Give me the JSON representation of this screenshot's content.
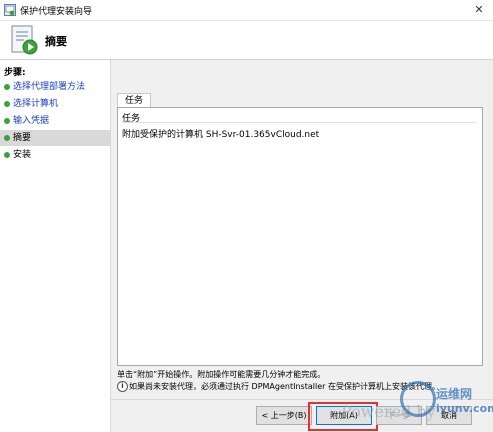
{
  "window": {
    "title": "保护代理安装向导",
    "close_glyph": "✕"
  },
  "header": {
    "title": "摘要"
  },
  "sidebar": {
    "steps_label": "步骤:",
    "items": [
      {
        "label": "选择代理部署方法",
        "state": "done"
      },
      {
        "label": "选择计算机",
        "state": "done"
      },
      {
        "label": "输入凭据",
        "state": "done"
      },
      {
        "label": "摘要",
        "state": "current"
      },
      {
        "label": "安装",
        "state": "pending"
      }
    ]
  },
  "main": {
    "tab_label": "任务",
    "table": {
      "header": "任务",
      "rows": [
        "附加受保护的计算机 SH-Svr-01.365vCloud.net"
      ]
    },
    "footer_text": "单击“附加”开始操作。附加操作可能需要几分钟才能完成。",
    "info_text": "如果尚未安装代理，必须通过执行 DPMAgentInstaller 在受保护计算机上安装该代理。",
    "info_icon": "i"
  },
  "buttons": {
    "back": "< 上一步(B)",
    "attach": "附加(A)",
    "next": "下一步",
    "cancel": "取消"
  },
  "watermark": {
    "text": "Powered by",
    "brand": "运维网",
    "site": "iyunv.com"
  },
  "colors": {
    "link": "#1a3ec5",
    "dot_green": "#3aa33a",
    "dot_gray": "#9a9a9a",
    "highlight_red": "#e53030"
  }
}
